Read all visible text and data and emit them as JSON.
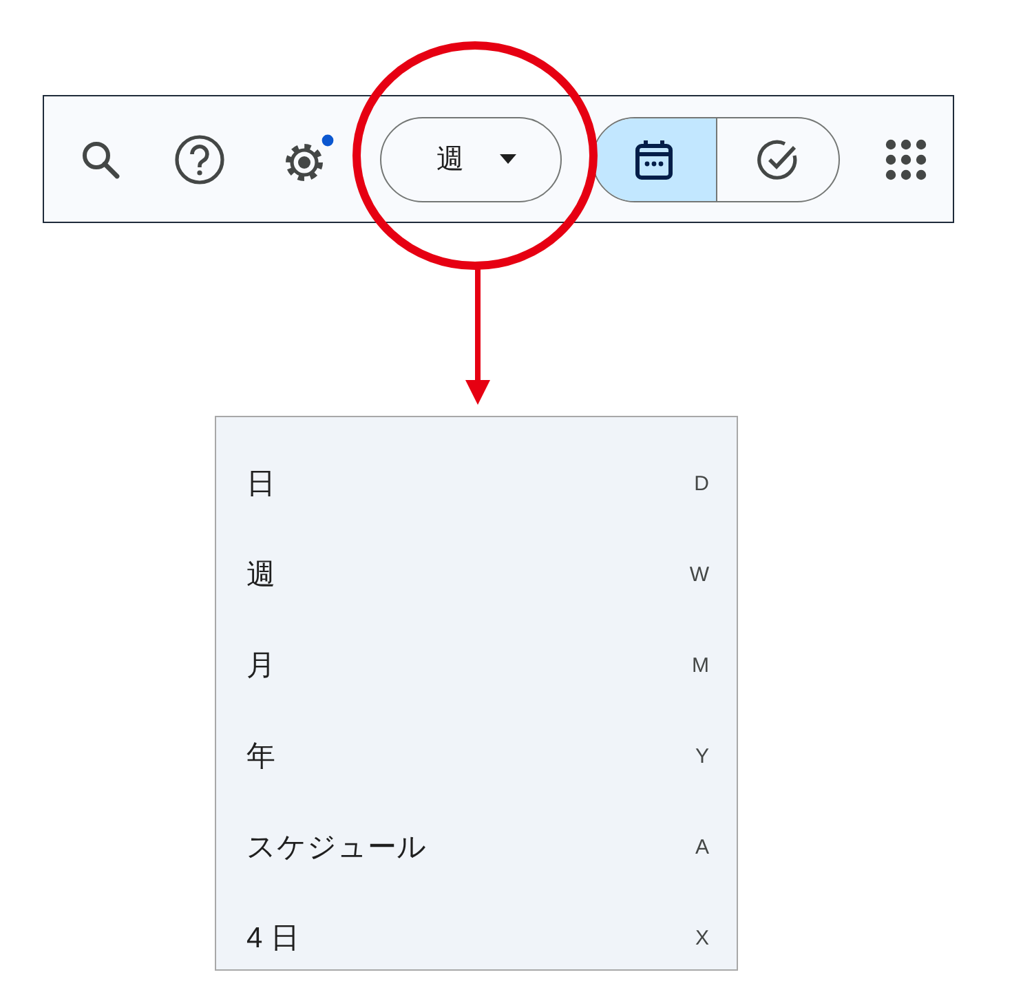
{
  "toolbar": {
    "settings_badge": true,
    "view_dropdown": {
      "label": "週"
    },
    "mode_toggle": [
      {
        "kind": "calendar",
        "selected": true
      },
      {
        "kind": "tasks",
        "selected": false
      }
    ]
  },
  "view_menu": {
    "items": [
      {
        "label": "日",
        "shortcut": "D"
      },
      {
        "label": "週",
        "shortcut": "W"
      },
      {
        "label": "月",
        "shortcut": "M"
      },
      {
        "label": "年",
        "shortcut": "Y"
      },
      {
        "label": "スケジュール",
        "shortcut": "A"
      },
      {
        "label": "4 日",
        "shortcut": "X"
      }
    ]
  }
}
